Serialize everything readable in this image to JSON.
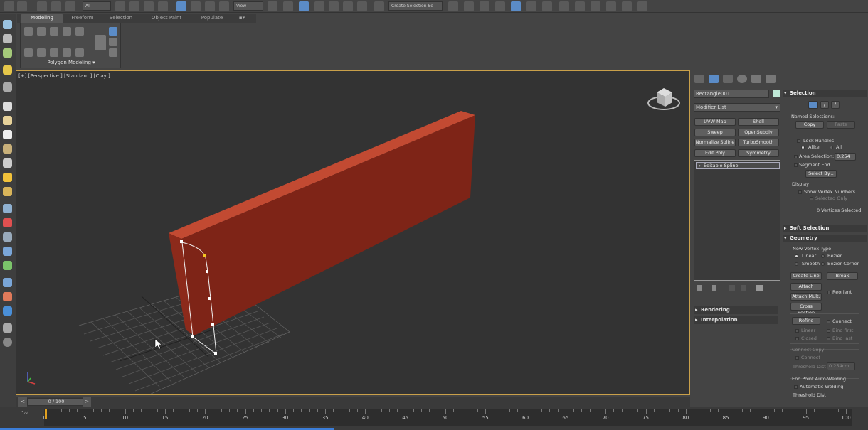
{
  "toolbar": {
    "selection_filter": "All",
    "coord_system": "View",
    "named_selection": "Create Selection Se"
  },
  "ribbon": {
    "tabs": [
      "Modeling",
      "Freeform",
      "Selection",
      "Object Paint",
      "Populate"
    ],
    "active_tab": "Modeling",
    "panel_label": "Polygon Modeling"
  },
  "viewport": {
    "label": "[+] [Perspective ] [Standard ] [Clay ]"
  },
  "command_panel": {
    "object_name": "Rectangle001",
    "object_color": "#bfe8d6",
    "modifier_list": "Modifier List",
    "modifier_buttons": [
      "UVW Map",
      "Shell",
      "Sweep",
      "OpenSubdiv",
      "Normalize Spline",
      "TurboSmooth",
      "Edit Poly",
      "Symmetry"
    ],
    "stack_item": "Editable Spline",
    "rollouts": [
      "Rendering",
      "Interpolation"
    ]
  },
  "selection_rollout": {
    "title": "Selection",
    "named_selections": "Named Selections:",
    "copy": "Copy",
    "paste": "Paste",
    "lock_handles": "Lock Handles",
    "alike": "Alike",
    "all": "All",
    "area_selection": "Area Selection:",
    "area_value": "0.254",
    "segment_end": "Segment End",
    "select_by": "Select By...",
    "display": "Display",
    "show_vertex_numbers": "Show Vertex Numbers",
    "selected_only": "Selected Only",
    "status": "0 Vertices Selected"
  },
  "soft_selection": {
    "title": "Soft Selection"
  },
  "geometry": {
    "title": "Geometry",
    "new_vertex_type": "New Vertex Type",
    "linear": "Linear",
    "bezier": "Bezier",
    "smooth": "Smooth",
    "bezier_corner": "Bezier Corner",
    "create_line": "Create Line",
    "break": "Break",
    "attach": "Attach",
    "reorient": "Reorient",
    "attach_mult": "Attach Mult.",
    "cross_section": "Cross Section",
    "refine": "Refine",
    "connect": "Connect",
    "linear2": "Linear",
    "bind_first": "Bind first",
    "closed": "Closed",
    "bind_last": "Bind last",
    "connect_copy": "Connect Copy",
    "connect2": "Connect",
    "threshold": "Threshold Dist",
    "threshold_value": "0.254cm",
    "end_point_welding": "End Point Auto-Welding",
    "automatic_welding": "Automatic Welding",
    "threshold2": "Threshold Dist"
  },
  "time": {
    "frame_display": "0 / 100",
    "prev": "<",
    "next": ">",
    "ticks": [
      "0",
      "5",
      "10",
      "15",
      "20",
      "25",
      "30",
      "35",
      "40",
      "45",
      "50",
      "55",
      "60",
      "65",
      "70",
      "75",
      "80",
      "85",
      "90",
      "95",
      "100"
    ],
    "tick_values": [
      0,
      5,
      10,
      15,
      20,
      25,
      30,
      35,
      40,
      45,
      50,
      55,
      60,
      65,
      70,
      75,
      80,
      85,
      90,
      95,
      100
    ],
    "current_frame": 0,
    "total_frames": 100
  }
}
